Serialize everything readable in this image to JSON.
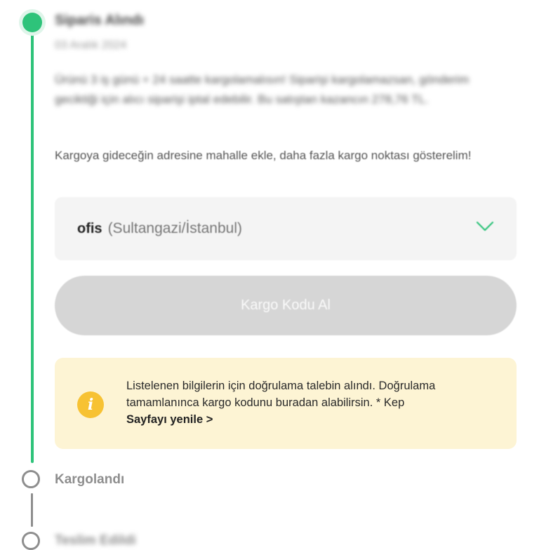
{
  "timeline": {
    "current_step": {
      "title": "Siparis Alındı",
      "date": "03 Aralık 2024",
      "description": "Ürünü 3 iş günü + 24 saatte kargolamalısın! Siparişi kargolamazsan, gönderim geciktiği için alıcı siparişi iptal edebilir. Bu satıştan kazancın 278,76 TL."
    },
    "next_step": {
      "title": "Kargolandı"
    },
    "following_step": {
      "title": "Teslim Edildi"
    }
  },
  "address_hint": "Kargoya gideceğin adresine mahalle ekle, daha fazla kargo noktası gösterelim!",
  "address_select": {
    "name": "ofis",
    "detail": "(Sultangazi/İstanbul)",
    "icon": "chevron-down-icon"
  },
  "kargo_button": {
    "label": "Kargo Kodu Al",
    "disabled": true
  },
  "info_box": {
    "icon": "info-icon",
    "icon_glyph": "i",
    "text": "Listelenen bilgilerin için doğrulama talebin alındı. Doğrulama tamamlanınca kargo kodunu buradan alabilirsin. * Kep",
    "link_label": "Sayfayı yenile >"
  },
  "colors": {
    "accent_green": "#2ec37a",
    "inactive_grey": "#8e8e8e",
    "info_background": "#fdf4d4",
    "info_icon": "#f7c233",
    "button_disabled": "#d6d6d6"
  }
}
